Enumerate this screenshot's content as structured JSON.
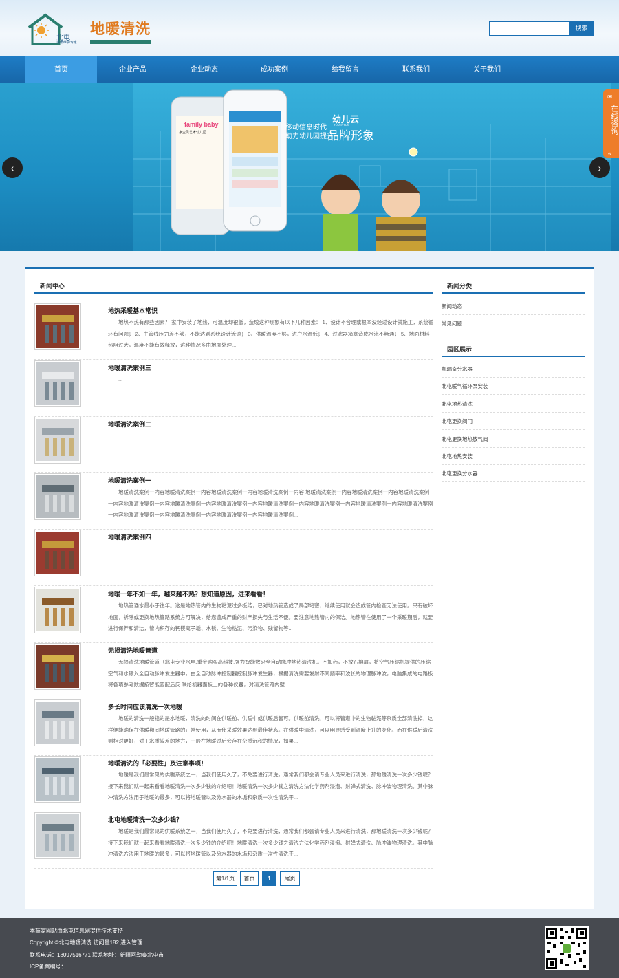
{
  "header": {
    "logo_text": "北屯",
    "logo_sub": "地暖维护专家",
    "brand": "地暖清洗",
    "search_placeholder": "",
    "search_button": "搜索"
  },
  "nav": [
    "首页",
    "企业产品",
    "企业动态",
    "成功案例",
    "给我留言",
    "联系我们",
    "关于我们"
  ],
  "banner": {
    "slogan_line1": "移动信息时代",
    "slogan_line2": "助力幼儿园提升",
    "slogan_big": "品牌形象",
    "brand_name": "幼儿云",
    "brand_en": "YOUERYUN",
    "phone_app": "family baby",
    "phone_sub": "家宝贝艺术幼儿园",
    "prev": "‹",
    "next": "›"
  },
  "side_tab": "在线咨询",
  "news_center": {
    "title": "新闻中心",
    "items": [
      {
        "title": "地热采暖基本常识",
        "summary": "地热不热有那些因素？    家中安装了地热，可温度却很低，造成这种现象有以下几种因素：    1、设计不合理或根本没经过设计就施工，系统循环有问题；    2、主管线压力差不够，不能达到系统设计流速；    3、供暖温度不够，进户水温低；    4、过滤器堵塞造成水流不畅通；    5、地面材料热阻过大，温度不能有效释放，这种情况多由地面处理..."
      },
      {
        "title": "地暖清洗案例三",
        "summary": "..."
      },
      {
        "title": "地暖清洗案例二",
        "summary": "..."
      },
      {
        "title": "地暖清洗案例一",
        "summary": "地暖清洗案例一内容地暖清洗案例一内容地暖清洗案例一内容地暖清洗案例一内容 地暖清洗案例一内容地暖清洗案例一内容地暖清洗案例一内容地暖清洗案例一内容地暖清洗案例一内容地暖清洗案例一内容地暖清洗案例一内容地暖清洗案例一内容地暖清洗案例一内容地暖清洗案例一内容地暖清洗案例一内容地暖清洗案例一内容地暖清洗案例一内容地暖清洗案例..."
      },
      {
        "title": "地暖清洗案例四",
        "summary": "..."
      },
      {
        "title": "地暖一年不如一年，越来越不热？想知道原因，进来看看！",
        "summary": "地热管通水最小于往年。这是地热管内的生物粘泥过多板结，已对地热管造成了局部堵塞，继续使用就会造成管内检查无法使用。只有破坏地面，拆除或更换地热管路系统方可解决，给您造成严重的财产损失与生活不便。要注意地热管内的保洁。地热管在使用了一个采暖期后，就要进行保养和清洁，管内积存的钙镁离子垢、水锈、生物粘泥、污染物、残留物等..."
      },
      {
        "title": "无损清洗地暖管道",
        "summary": "无损清洗地暖管道（北屯专业水电,重金购买高科技,强力智能数码全自动脉冲地热清洗机。不加药，不放石棉屑，将空气压缩机提供的压缩空气和水输入全自动脉冲发生器中，由全自动脉冲控制器控制脉冲发生器，根据清洗需要发射不同频率和波长的物理脉冲波，电脑集成的电路板将各项参考数据按智能匹配后反 映给机器面板上的各种仪器，对清洗管路内壁..."
      },
      {
        "title": "多长时间应该清洗一次地暖",
        "summary": "地暖的清洗一般指的是水地暖，清洗的时间在供暖前、供暖中或供暖后皆可。供暖前清洗，可以将管道中的生物黏泥等杂质全部清洗掉，这样便能确保在供暖期间地暖管路的正常使用，从而使采暖效果达到最佳状态。在供暖中清洗，可以明显感受到温度上升的变化。而在供暖后清洗则相对更好，对于水质较差的地方，一般在地暖过后会存在杂质沉积的情况，如果..."
      },
      {
        "title": "地暖清洗的「必要性」及注意事项！",
        "summary": "地暖是我们最常见的供暖系统之一，当我们使用久了，不免要进行清洗，通常我们都会请专业人员来进行清洗，那地暖清洗一次多少钱呢？接下来我们就一起来看看地暖清洗一次多少钱的介绍吧！地暖清洗一次多少钱之清洗方法化学药剂浸泡、射弹式清洗、脉冲波物理清洗。其中脉冲清洗方法用于地暖的最多，可以将地暖管以及分水器的水垢和杂质一次性清洗干..."
      },
      {
        "title": "北屯地暖清洗一次多少钱？",
        "summary": "地暖是我们最常见的供暖系统之一，当我们使用久了，不免要进行清洗，通常我们都会请专业人员来进行清洗，那地暖清洗一次多少钱呢？接下来我们就一起来看看地暖清洗一次多少钱的介绍吧！地暖清洗一次多少钱之清洗方法化学药剂浸泡、射弹式清洗、脉冲波物理清洗。其中脉冲清洗方法用于地暖的最多，可以将地暖管以及分水器的水垢和杂质一次性清洗干..."
      }
    ]
  },
  "pager": {
    "info": "第1/1页",
    "first": "首页",
    "current": "1",
    "last": "尾页"
  },
  "sidebar": {
    "news_categories_title": "新闻分类",
    "news_categories": [
      "新闻动态",
      "常见问题"
    ],
    "showcase_title": "园区展示",
    "showcase": [
      "凯瑞奇分水器",
      "北屯暖气循环泵安装",
      "北屯地热清洗",
      "北屯更换阀门",
      "北屯更换地热放气阀",
      "北屯地热安装",
      "北屯更换分水器"
    ]
  },
  "footer": {
    "line1": "本商家网站由北屯信息网提供技术支持",
    "line2": "Copyright ©北屯地暖清洗 访问量182 进入管理",
    "line3": "联系电话：18097516771 联系地址：新疆阿勒泰北屯市",
    "line4": "ICP备案编号："
  },
  "colors": {
    "primary": "#1a6fb3",
    "nav_active": "#3c9de3",
    "brand_orange": "#e07a1f",
    "footer_bg": "#474a50",
    "side_tab": "#ee7d2a"
  }
}
